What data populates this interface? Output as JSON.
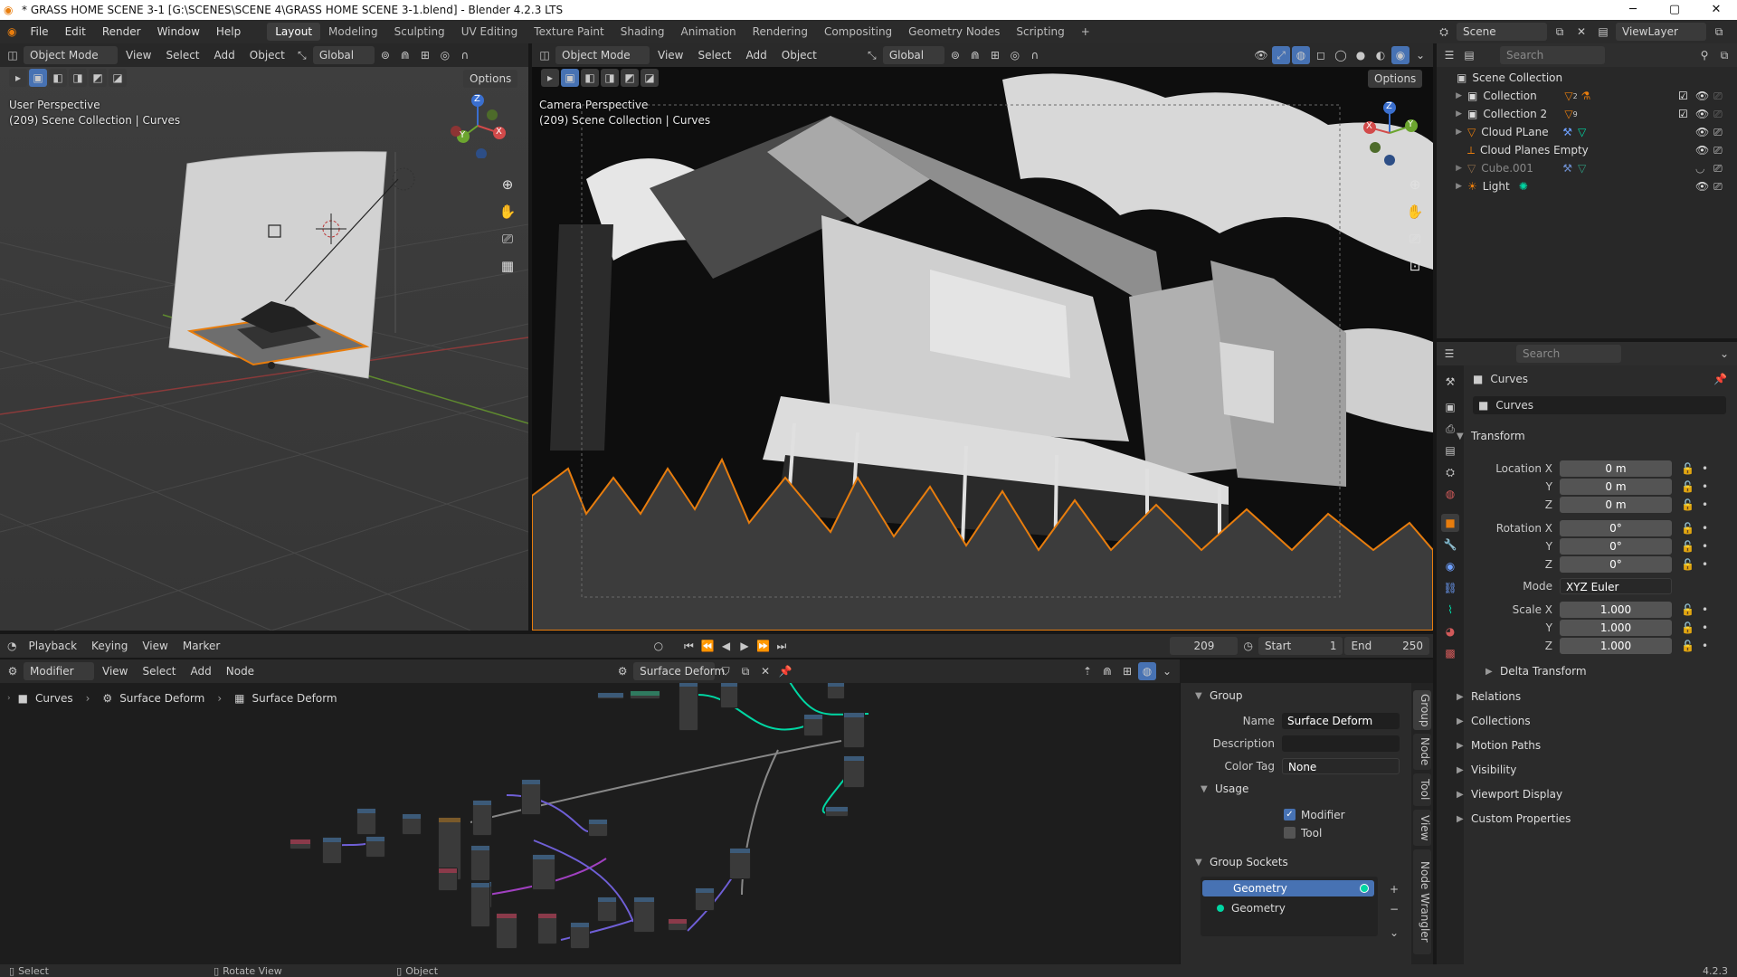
{
  "window": {
    "title": "* GRASS HOME SCENE 3-1 [G:\\SCENES\\SCENE 4\\GRASS HOME SCENE 3-1.blend] - Blender 4.2.3 LTS",
    "minimize": "─",
    "maximize": "▢",
    "close": "✕"
  },
  "menu": {
    "items": [
      "File",
      "Edit",
      "Render",
      "Window",
      "Help"
    ],
    "workspaces": [
      "Layout",
      "Modeling",
      "Sculpting",
      "UV Editing",
      "Texture Paint",
      "Shading",
      "Animation",
      "Rendering",
      "Compositing",
      "Geometry Nodes",
      "Scripting"
    ],
    "active_workspace": "Layout",
    "add": "+",
    "scene": "Scene",
    "viewlayer": "ViewLayer"
  },
  "viewport_left": {
    "mode": "Object Mode",
    "menus": [
      "View",
      "Select",
      "Add",
      "Object"
    ],
    "orientation": "Global",
    "options": "Options",
    "perspective": "User Perspective",
    "context": "(209) Scene Collection | Curves"
  },
  "viewport_right": {
    "mode": "Object Mode",
    "menus": [
      "View",
      "Select",
      "Add",
      "Object"
    ],
    "orientation": "Global",
    "options": "Options",
    "perspective": "Camera Perspective",
    "context": "(209) Scene Collection | Curves"
  },
  "gizmo": {
    "x": "X",
    "y": "Y",
    "z": "Z"
  },
  "outliner": {
    "search_placeholder": "Search",
    "root": "Scene Collection",
    "items": [
      {
        "name": "Collection",
        "sub": "2"
      },
      {
        "name": "Collection 2",
        "sub": "9"
      },
      {
        "name": "Cloud PLane",
        "sub": ""
      },
      {
        "name": "Cloud Planes Empty",
        "sub": ""
      },
      {
        "name": "Cube.001",
        "sub": ""
      },
      {
        "name": "Light",
        "sub": ""
      }
    ]
  },
  "properties": {
    "search_placeholder": "Search",
    "object_name": "Curves",
    "datablock": "Curves",
    "transform": "Transform",
    "location_label": "Location X",
    "rotation_label": "Rotation X",
    "scale_label": "Scale X",
    "mode_label": "Mode",
    "y": "Y",
    "z": "Z",
    "location": [
      "0 m",
      "0 m",
      "0 m"
    ],
    "rotation": [
      "0°",
      "0°",
      "0°"
    ],
    "mode": "XYZ Euler",
    "scale": [
      "1.000",
      "1.000",
      "1.000"
    ],
    "sections": [
      "Delta Transform",
      "Relations",
      "Collections",
      "Motion Paths",
      "Visibility",
      "Viewport Display",
      "Custom Properties"
    ]
  },
  "timeline": {
    "menus": [
      "Playback",
      "Keying",
      "View",
      "Marker"
    ],
    "frame": "209",
    "start_label": "Start",
    "start": "1",
    "end_label": "End",
    "end": "250"
  },
  "node_editor": {
    "type": "Modifier",
    "menus": [
      "View",
      "Select",
      "Add",
      "Node"
    ],
    "tree_name": "Surface Deform",
    "breadcrumb": [
      "Curves",
      "Surface Deform",
      "Surface Deform"
    ]
  },
  "group_panel": {
    "group": "Group",
    "name_label": "Name",
    "name": "Surface Deform",
    "description_label": "Description",
    "description": "",
    "color_tag_label": "Color Tag",
    "color_tag": "None",
    "usage": "Usage",
    "modifier": "Modifier",
    "tool": "Tool",
    "sockets": "Group Sockets",
    "socket_output": "Geometry",
    "socket_input": "Geometry",
    "tabs": [
      "Group",
      "Node",
      "Tool",
      "View",
      "Node Wrangler"
    ]
  },
  "statusbar": {
    "select": "Select",
    "rotate": "Rotate View",
    "object": "Object",
    "version": "4.2.3"
  },
  "colors": {
    "accent": "#e87d0d",
    "selection": "#4772b3",
    "socket_geo": "#00d6a3"
  }
}
